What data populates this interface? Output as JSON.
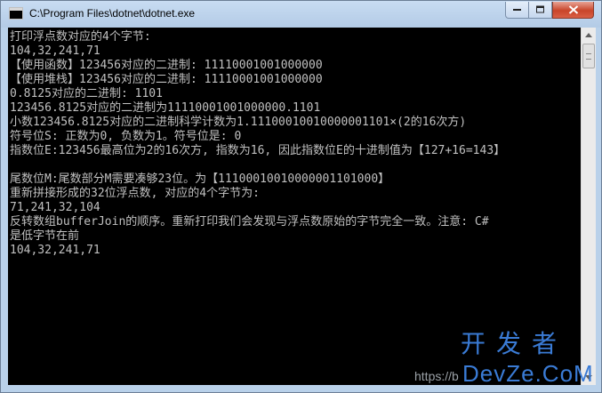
{
  "window": {
    "title": "C:\\Program Files\\dotnet\\dotnet.exe"
  },
  "console": {
    "lines": [
      "打印浮点数对应的4个字节:",
      "104,32,241,71",
      "【使用函数】123456对应的二进制: 11110001001000000",
      "【使用堆栈】123456对应的二进制: 11110001001000000",
      "0.8125对应的二进制: 1101",
      "123456.8125对应的二进制为11110001001000000.1101",
      "小数123456.8125对应的二进制科学计数为1.11100010010000001101×(2的16次方)",
      "符号位S: 正数为0, 负数为1。符号位是: 0",
      "指数位E:123456最高位为2的16次方, 指数为16, 因此指数位E的十进制值为【127+16=143】",
      "",
      "尾数位M:尾数部分M需要凑够23位。为【11100010010000001101000】",
      "重新拼接形成的32位浮点数, 对应的4个字节为:",
      "71,241,32,104",
      "反转数组bufferJoin的顺序。重新打印我们会发现与浮点数原始的字节完全一致。注意: C#",
      "是低字节在前",
      "104,32,241,71"
    ],
    "text_color": "#c0c0c0",
    "background": "#000000"
  },
  "watermark": {
    "cn": "开发者",
    "en": "DevZe.CoM",
    "url": "https://b"
  }
}
